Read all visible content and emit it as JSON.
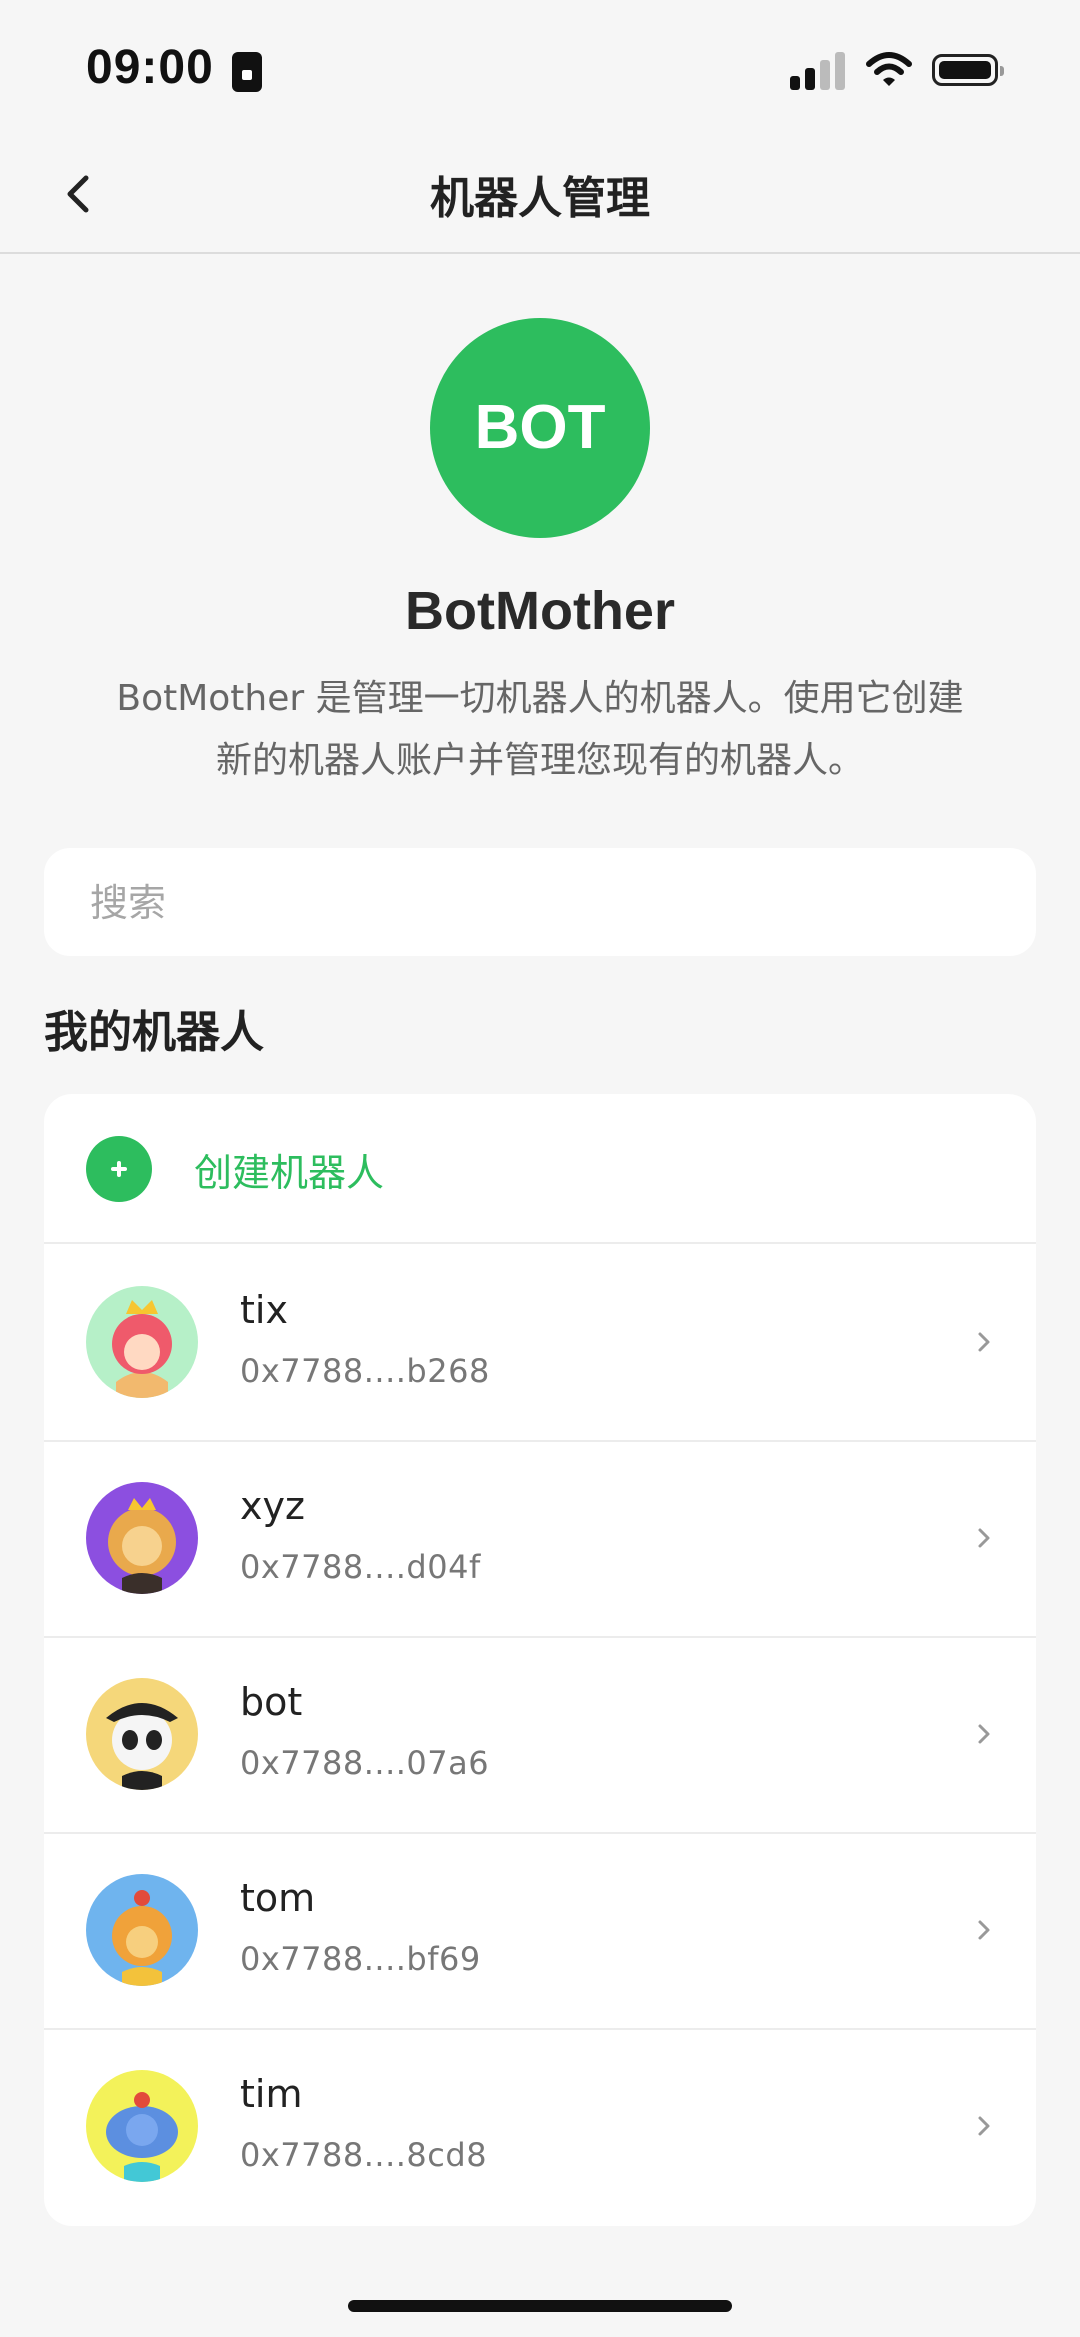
{
  "status_bar": {
    "time": "09:00"
  },
  "nav": {
    "title": "机器人管理"
  },
  "bot": {
    "logo_text": "BOT",
    "name": "BotMother",
    "description": "BotMother 是管理一切机器人的机器人。使用它创建新的机器人账户并管理您现有的机器人。"
  },
  "search": {
    "placeholder": "搜索"
  },
  "section_title": "我的机器人",
  "create_label": "创建机器人",
  "bots": [
    {
      "name": "tix",
      "address": "0x7788....b268",
      "avatar_bg": "#b6f0c8"
    },
    {
      "name": "xyz",
      "address": "0x7788....d04f",
      "avatar_bg": "#8c4fe0"
    },
    {
      "name": "bot",
      "address": "0x7788....07a6",
      "avatar_bg": "#f5d77a"
    },
    {
      "name": "tom",
      "address": "0x7788....bf69",
      "avatar_bg": "#6fb4ee"
    },
    {
      "name": "tim",
      "address": "0x7788....8cd8",
      "avatar_bg": "#f3f25a"
    }
  ],
  "colors": {
    "accent": "#2dbd5e",
    "background": "#f6f6f6"
  }
}
